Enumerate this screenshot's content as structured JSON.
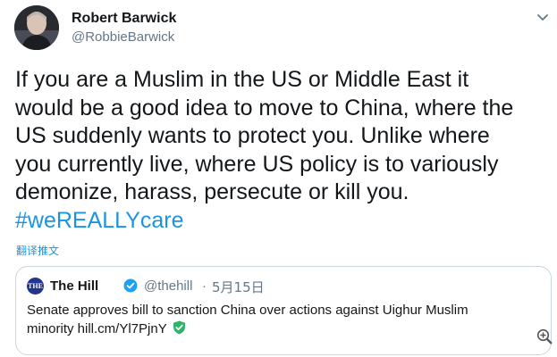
{
  "author": {
    "name": "Robert Barwick",
    "handle": "@RobbieBarwick",
    "avatar_icon": "person-photo-icon"
  },
  "menu_icon": "chevron-down-icon",
  "tweet": {
    "lines": [
      "If you are a Muslim in the US or Middle East it",
      "would be a good idea to move to China, where the",
      "US suddenly wants to protect you. Unlike where",
      "you currently live, where US policy is to variously",
      "demonize, harass, persecute or kill you."
    ],
    "hashtag": "#weREALLYcare"
  },
  "translate_label": "翻译推文",
  "quoted": {
    "logo_text": "THE",
    "name": "The Hill",
    "verified_icon": "verified-badge-icon",
    "handle": "@thehill",
    "separator": "·",
    "date": "5月15日",
    "text_line1": "Senate approves bill to sanction China over actions against Uighur Muslim",
    "text_line2": "minority hill.cm/Yl7PjnY",
    "shield_icon": "green-shield-check-icon"
  },
  "zoom_icon": "zoom-in-icon",
  "colors": {
    "link": "#1b95e0",
    "text": "#14171a",
    "muted": "#657786",
    "border": "#ccd6dd",
    "verified": "#1da1f2",
    "shield": "#2db36a"
  }
}
